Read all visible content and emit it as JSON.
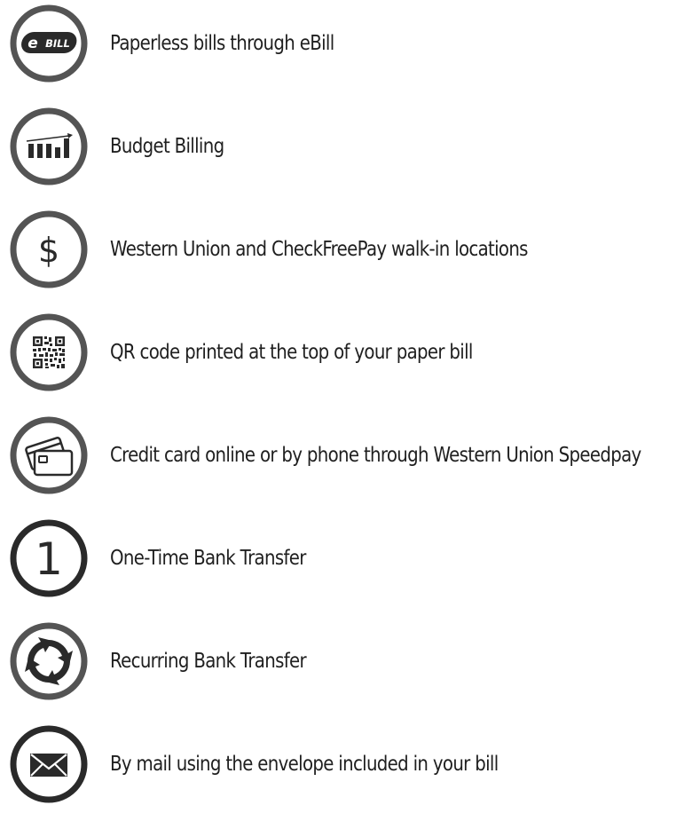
{
  "colors": {
    "ring": "#545454",
    "icon": "#2a2a2a",
    "text": "#1f1f1f",
    "background": "#ffffff"
  },
  "items": [
    {
      "icon": "ebill-logo-icon",
      "logo_text": "BILL",
      "label": "Paperless bills through eBill"
    },
    {
      "icon": "bar-chart-icon",
      "label": "Budget Billing"
    },
    {
      "icon": "dollar-icon",
      "glyph": "$",
      "label": "Western Union and CheckFreePay walk-in locations"
    },
    {
      "icon": "qr-code-icon",
      "label": "QR code printed at the top of your paper bill"
    },
    {
      "icon": "credit-cards-icon",
      "label": "Credit card online or by phone through Western Union Speedpay"
    },
    {
      "icon": "number-one-icon",
      "glyph": "1",
      "label": "One-Time Bank Transfer"
    },
    {
      "icon": "recurring-arrows-icon",
      "label": "Recurring Bank Transfer"
    },
    {
      "icon": "envelope-icon",
      "label": "By mail using the envelope included in your bill"
    }
  ]
}
